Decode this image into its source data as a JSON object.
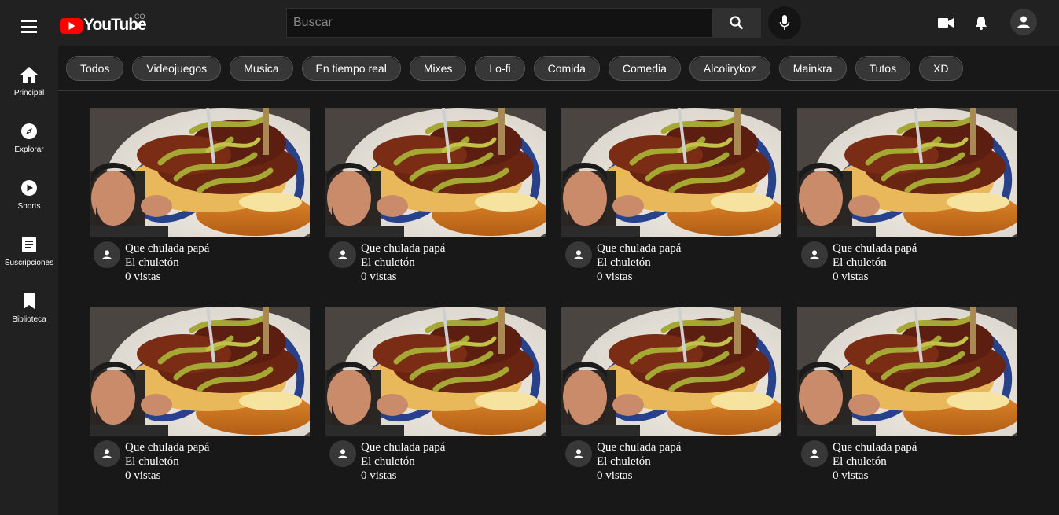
{
  "app": {
    "logo_text": "YouTube",
    "logo_region": "CO",
    "brand_red": "#ff0000"
  },
  "sidebar": {
    "items": [
      {
        "label": "Principal",
        "icon": "home-icon"
      },
      {
        "label": "Explorar",
        "icon": "compass-icon"
      },
      {
        "label": "Shorts",
        "icon": "shorts-icon"
      },
      {
        "label": "Suscripciones",
        "icon": "subscriptions-icon"
      },
      {
        "label": "Biblioteca",
        "icon": "library-icon"
      }
    ]
  },
  "search": {
    "placeholder": "Buscar",
    "value": ""
  },
  "chips": [
    "Todos",
    "Videojuegos",
    "Musica",
    "En tiempo real",
    "Mixes",
    "Lo-fi",
    "Comida",
    "Comedia",
    "Alcolirykoz",
    "Mainkra",
    "Tutos",
    "XD"
  ],
  "videos": [
    {
      "title": "Que chulada papá",
      "channel": "El chuletón",
      "views": "0 vistas"
    },
    {
      "title": "Que chulada papá",
      "channel": "El chuletón",
      "views": "0 vistas"
    },
    {
      "title": "Que chulada papá",
      "channel": "El chuletón",
      "views": "0 vistas"
    },
    {
      "title": "Que chulada papá",
      "channel": "El chuletón",
      "views": "0 vistas"
    },
    {
      "title": "Que chulada papá",
      "channel": "El chuletón",
      "views": "0 vistas"
    },
    {
      "title": "Que chulada papá",
      "channel": "El chuletón",
      "views": "0 vistas"
    },
    {
      "title": "Que chulada papá",
      "channel": "El chuletón",
      "views": "0 vistas"
    },
    {
      "title": "Que chulada papá",
      "channel": "El chuletón",
      "views": "0 vistas"
    }
  ]
}
